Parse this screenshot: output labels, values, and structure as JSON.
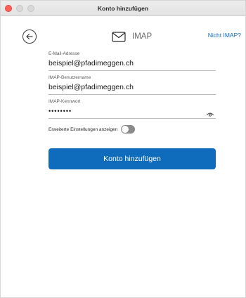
{
  "window": {
    "title": "Konto hinzufügen"
  },
  "header": {
    "back_icon": "arrow-left-circle-icon",
    "protocol_icon": "envelope-icon",
    "protocol_label": "IMAP",
    "switch_link": "Nicht IMAP?"
  },
  "form": {
    "email": {
      "label": "E-Mail-Adresse",
      "value": "beispiel@pfadimeggen.ch"
    },
    "username": {
      "label": "IMAP-Benutzername",
      "value": "beispiel@pfadimeggen.ch"
    },
    "password": {
      "label": "IMAP-Kennwort",
      "value": "••••••••",
      "reveal_icon": "eye-icon"
    },
    "advanced": {
      "label": "Erweiterte Einstellungen anzeigen",
      "enabled": false
    },
    "submit_label": "Konto hinzufügen"
  },
  "colors": {
    "accent": "#0f6cbd",
    "close_button": "#ff5f57",
    "toggle_off": "#8a8a8a"
  }
}
